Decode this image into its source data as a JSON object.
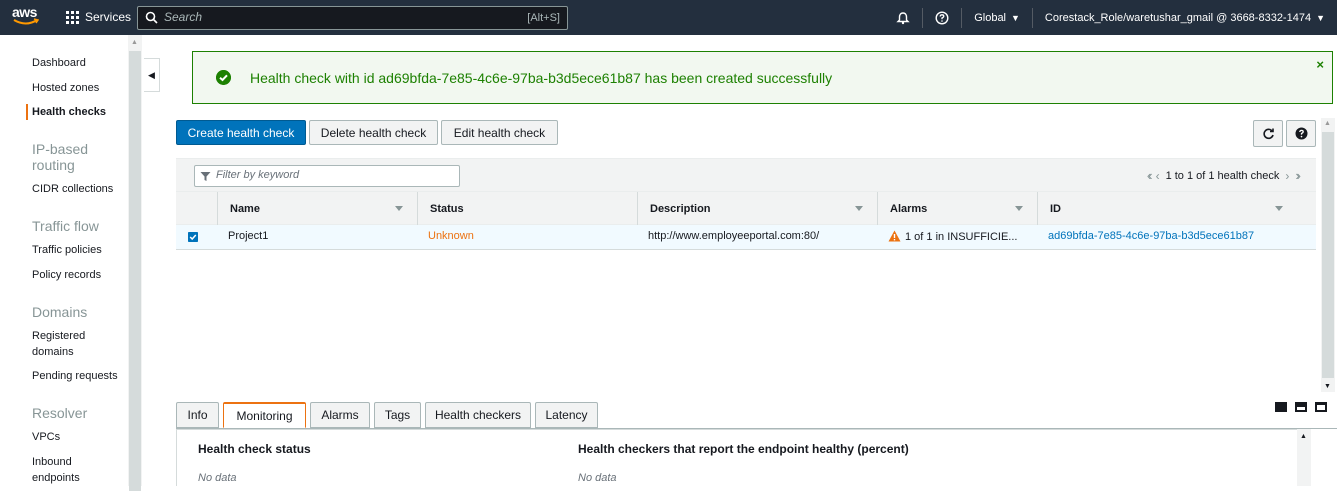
{
  "topnav": {
    "logo_text": "aws",
    "services_label": "Services",
    "search_placeholder": "Search",
    "search_hint": "[Alt+S]",
    "region_label": "Global",
    "account_label": "Corestack_Role/waretushar_gmail @ 3668-8332-1474"
  },
  "sidebar": {
    "links": {
      "dashboard": "Dashboard",
      "hosted_zones": "Hosted zones",
      "health_checks": "Health checks",
      "cidr_collections": "CIDR collections",
      "traffic_policies": "Traffic policies",
      "policy_records": "Policy records",
      "registered_domains_1": "Registered",
      "registered_domains_2": "domains",
      "pending_requests": "Pending requests",
      "vpcs": "VPCs",
      "inbound_endpoints_1": "Inbound",
      "inbound_endpoints_2": "endpoints"
    },
    "headings": {
      "ip_routing_1": "IP-based",
      "ip_routing_2": "routing",
      "traffic_flow": "Traffic flow",
      "domains": "Domains",
      "resolver": "Resolver"
    }
  },
  "banner": {
    "message": "Health check with id ad69bfda-7e85-4c6e-97ba-b3d5ece61b87 has been created successfully",
    "close": "×"
  },
  "toolbar": {
    "create": "Create health check",
    "delete": "Delete health check",
    "edit": "Edit health check"
  },
  "filter": {
    "placeholder": "Filter by keyword",
    "pager_text": "1 to 1 of 1 health check"
  },
  "table": {
    "headers": {
      "name": "Name",
      "status": "Status",
      "description": "Description",
      "alarms": "Alarms",
      "id": "ID"
    },
    "rows": [
      {
        "name": "Project1",
        "status": "Unknown",
        "description": "http://www.employeeportal.com:80/",
        "alarms": "1 of 1 in INSUFFICIE...",
        "id": "ad69bfda-7e85-4c6e-97ba-b3d5ece61b87"
      }
    ]
  },
  "tabs": {
    "info": "Info",
    "monitoring": "Monitoring",
    "alarms": "Alarms",
    "tags": "Tags",
    "health_checkers": "Health checkers",
    "latency": "Latency"
  },
  "monitoring": {
    "status_heading": "Health check status",
    "status_value": "No data",
    "healthy_heading": "Health checkers that report the endpoint healthy (percent)",
    "healthy_value": "No data"
  },
  "colors": {
    "nav_bg": "#232f3e",
    "primary": "#0073bb",
    "success": "#1d8102",
    "warning": "#ec7211"
  }
}
